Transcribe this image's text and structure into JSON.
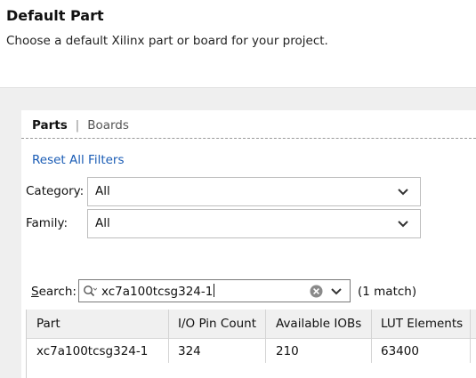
{
  "header": {
    "title": "Default Part",
    "subtitle": "Choose a default Xilinx part or board for your project."
  },
  "tabs": [
    {
      "label": "Parts",
      "active": true
    },
    {
      "label": "Boards",
      "active": false
    }
  ],
  "filters": {
    "reset_label": "Reset All Filters",
    "category": {
      "label": "Category:",
      "value": "All"
    },
    "family": {
      "label": "Family:",
      "value": "All"
    }
  },
  "search": {
    "label_prefix": "S",
    "label_rest": "earch:",
    "value": "xc7a100tcsg324-1",
    "match_text": "(1 match)"
  },
  "table": {
    "columns": [
      "Part",
      "I/O Pin Count",
      "Available IOBs",
      "LUT Elements"
    ],
    "rows": [
      [
        "xc7a100tcsg324-1",
        "324",
        "210",
        "63400"
      ]
    ]
  },
  "colors": {
    "link": "#1a5cb5",
    "band": "#efefef",
    "header_row": "#f0f0f0"
  }
}
